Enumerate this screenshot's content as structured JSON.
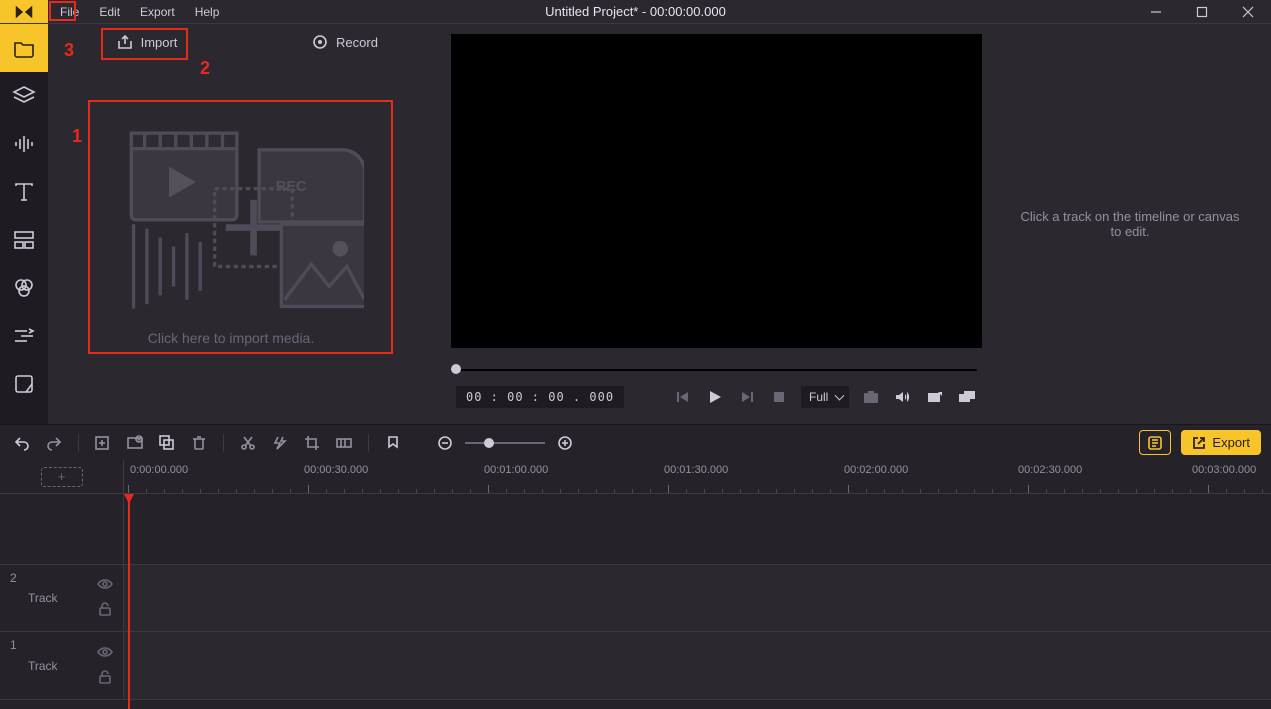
{
  "title": "Untitled Project* - 00:00:00.000",
  "menus": [
    "File",
    "Edit",
    "Export",
    "Help"
  ],
  "sidestrip": [
    {
      "name": "media-folder-icon",
      "active": true
    },
    {
      "name": "layers-icon"
    },
    {
      "name": "audio-icon"
    },
    {
      "name": "text-icon"
    },
    {
      "name": "templates-icon"
    },
    {
      "name": "filters-icon"
    },
    {
      "name": "transitions-icon"
    },
    {
      "name": "stickers-icon"
    }
  ],
  "mediapanel": {
    "import_label": "Import",
    "record_label": "Record",
    "dropzone_text": "Click here to import media.",
    "dropzone_rec": "REC"
  },
  "preview": {
    "timecode": "00 : 00 : 00 . 000",
    "aspect_selected": "Full"
  },
  "inspector_hint": "Click a track on the timeline or canvas to edit.",
  "toolbar": {
    "export_label": "Export"
  },
  "ruler_labels": [
    "0:00:00.000",
    "00:00:30.000",
    "00:01:00.000",
    "00:01:30.000",
    "00:02:00.000",
    "00:02:30.000",
    "00:03:00.000"
  ],
  "tracks": [
    {
      "index": "2",
      "label": "Track"
    },
    {
      "index": "1",
      "label": "Track"
    }
  ],
  "annotations": {
    "n1": "1",
    "n2": "2",
    "n3": "3"
  }
}
